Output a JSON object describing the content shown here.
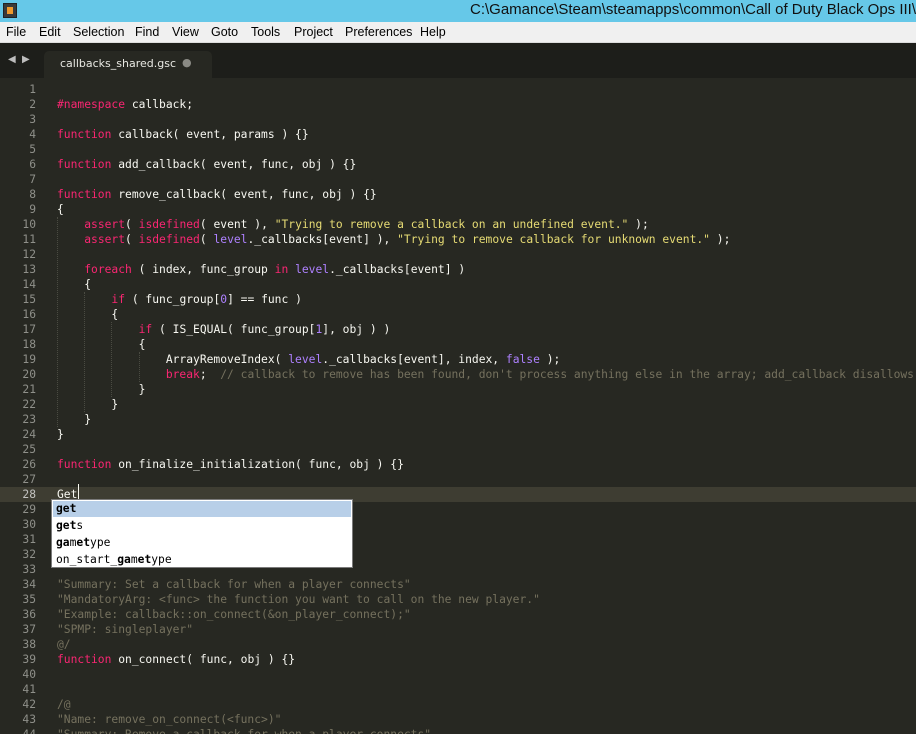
{
  "window": {
    "title": "C:\\Gamance\\Steam\\steamapps\\common\\Call of Duty Black Ops III\\"
  },
  "menu": [
    "File",
    "Edit",
    "Selection",
    "Find",
    "View",
    "Goto",
    "Tools",
    "Project",
    "Preferences",
    "Help"
  ],
  "tab": {
    "label": "callbacks_shared.gsc",
    "modified_dot": "●"
  },
  "nav": {
    "back": "◀",
    "forward": "▶"
  },
  "editor": {
    "current_line": 28,
    "lines": [
      {
        "n": "1",
        "t": []
      },
      {
        "n": "2",
        "t": [
          [
            "d",
            "#namespace"
          ],
          [
            "",
            " callback;"
          ]
        ]
      },
      {
        "n": "3",
        "t": []
      },
      {
        "n": "4",
        "t": [
          [
            "k",
            "function"
          ],
          [
            "",
            " callback( event, params ) {}"
          ]
        ]
      },
      {
        "n": "5",
        "t": []
      },
      {
        "n": "6",
        "t": [
          [
            "k",
            "function"
          ],
          [
            "",
            " add_callback( event, func, obj ) {}"
          ]
        ]
      },
      {
        "n": "7",
        "t": []
      },
      {
        "n": "8",
        "t": [
          [
            "k",
            "function"
          ],
          [
            "",
            " remove_callback( event, func, obj ) {}"
          ]
        ]
      },
      {
        "n": "9",
        "t": [
          [
            "",
            "{"
          ]
        ]
      },
      {
        "n": "10",
        "t": [
          [
            "",
            "    "
          ],
          [
            "k",
            "assert"
          ],
          [
            "",
            "( "
          ],
          [
            "k",
            "isdefined"
          ],
          [
            "",
            "( event ), "
          ],
          [
            "s",
            "\"Trying to remove a callback on an undefined event.\""
          ],
          [
            "",
            " );"
          ]
        ]
      },
      {
        "n": "11",
        "t": [
          [
            "",
            "    "
          ],
          [
            "k",
            "assert"
          ],
          [
            "",
            "( "
          ],
          [
            "k",
            "isdefined"
          ],
          [
            "",
            "( "
          ],
          [
            "g",
            "level"
          ],
          [
            "",
            "._callbacks[event] ), "
          ],
          [
            "s",
            "\"Trying to remove callback for unknown event.\""
          ],
          [
            "",
            " );"
          ]
        ]
      },
      {
        "n": "12",
        "t": []
      },
      {
        "n": "13",
        "t": [
          [
            "",
            "    "
          ],
          [
            "k",
            "foreach"
          ],
          [
            "",
            " ( index, func_group "
          ],
          [
            "k",
            "in"
          ],
          [
            "",
            " "
          ],
          [
            "g",
            "level"
          ],
          [
            "",
            "._callbacks[event] )"
          ]
        ]
      },
      {
        "n": "14",
        "t": [
          [
            "",
            "    {"
          ]
        ]
      },
      {
        "n": "15",
        "t": [
          [
            "",
            "        "
          ],
          [
            "k",
            "if"
          ],
          [
            "",
            " ( func_group["
          ],
          [
            "n",
            "0"
          ],
          [
            "",
            "] == func )"
          ]
        ]
      },
      {
        "n": "16",
        "t": [
          [
            "",
            "        {"
          ]
        ]
      },
      {
        "n": "17",
        "t": [
          [
            "",
            "            "
          ],
          [
            "k",
            "if"
          ],
          [
            "",
            " ( IS_EQUAL( func_group["
          ],
          [
            "n",
            "1"
          ],
          [
            "",
            "], obj ) )"
          ]
        ]
      },
      {
        "n": "18",
        "t": [
          [
            "",
            "            {"
          ]
        ]
      },
      {
        "n": "19",
        "t": [
          [
            "",
            "                ArrayRemoveIndex( "
          ],
          [
            "g",
            "level"
          ],
          [
            "",
            "._callbacks[event], index, "
          ],
          [
            "n",
            "false"
          ],
          [
            "",
            " );"
          ]
        ]
      },
      {
        "n": "20",
        "t": [
          [
            "",
            "                "
          ],
          [
            "k",
            "break"
          ],
          [
            "",
            ";  "
          ],
          [
            "c",
            "// callback to remove has been found, don't process anything else in the array; add_callback disallows duplicates"
          ]
        ]
      },
      {
        "n": "21",
        "t": [
          [
            "",
            "            }"
          ]
        ]
      },
      {
        "n": "22",
        "t": [
          [
            "",
            "        }"
          ]
        ]
      },
      {
        "n": "23",
        "t": [
          [
            "",
            "    }"
          ]
        ]
      },
      {
        "n": "24",
        "t": [
          [
            "",
            "}"
          ]
        ]
      },
      {
        "n": "25",
        "t": []
      },
      {
        "n": "26",
        "t": [
          [
            "k",
            "function"
          ],
          [
            "",
            " on_finalize_initialization( func, obj ) {}"
          ]
        ]
      },
      {
        "n": "27",
        "t": []
      },
      {
        "n": "28",
        "t": [
          [
            "",
            "Get"
          ]
        ]
      },
      {
        "n": "29",
        "t": []
      },
      {
        "n": "30",
        "t": []
      },
      {
        "n": "31",
        "t": []
      },
      {
        "n": "32",
        "t": []
      },
      {
        "n": "33",
        "t": []
      },
      {
        "n": "34",
        "t": [
          [
            "c",
            "\"Summary: Set a callback for when a player connects\""
          ]
        ]
      },
      {
        "n": "35",
        "t": [
          [
            "c",
            "\"MandatoryArg: <func> the function you want to call on the new player.\""
          ]
        ]
      },
      {
        "n": "36",
        "t": [
          [
            "c",
            "\"Example: callback::on_connect(&on_player_connect);\""
          ]
        ]
      },
      {
        "n": "37",
        "t": [
          [
            "c",
            "\"SPMP: singleplayer\""
          ]
        ]
      },
      {
        "n": "38",
        "t": [
          [
            "c",
            "@/"
          ]
        ]
      },
      {
        "n": "39",
        "t": [
          [
            "k",
            "function"
          ],
          [
            "",
            " on_connect( func, obj ) {}"
          ]
        ]
      },
      {
        "n": "40",
        "t": []
      },
      {
        "n": "41",
        "t": []
      },
      {
        "n": "42",
        "t": [
          [
            "c",
            "/@"
          ]
        ]
      },
      {
        "n": "43",
        "t": [
          [
            "c",
            "\"Name: remove_on_connect(<func>)\""
          ]
        ]
      },
      {
        "n": "44",
        "t": [
          [
            "c",
            "\"Summary: Remove a callback for when a player connects\""
          ]
        ]
      }
    ]
  },
  "autocomplete": {
    "items": [
      {
        "parts": [
          [
            "b",
            "get"
          ]
        ],
        "selected": true
      },
      {
        "parts": [
          [
            "b",
            "get"
          ],
          [
            "",
            "s"
          ]
        ],
        "selected": false
      },
      {
        "parts": [
          [
            "b",
            "ga"
          ],
          [
            "",
            "m"
          ],
          [
            "b",
            "et"
          ],
          [
            "",
            "ype"
          ]
        ],
        "selected": false
      },
      {
        "parts": [
          [
            "",
            "on_start_"
          ],
          [
            "b",
            "ga"
          ],
          [
            "",
            "m"
          ],
          [
            "b",
            "et"
          ],
          [
            "",
            "ype"
          ]
        ],
        "selected": false
      }
    ]
  },
  "colors": {
    "background": "#272822",
    "keyword": "#f92672",
    "string": "#e6db74",
    "comment": "#75715e",
    "number": "#ae81ff",
    "foreground": "#f8f8f2"
  }
}
